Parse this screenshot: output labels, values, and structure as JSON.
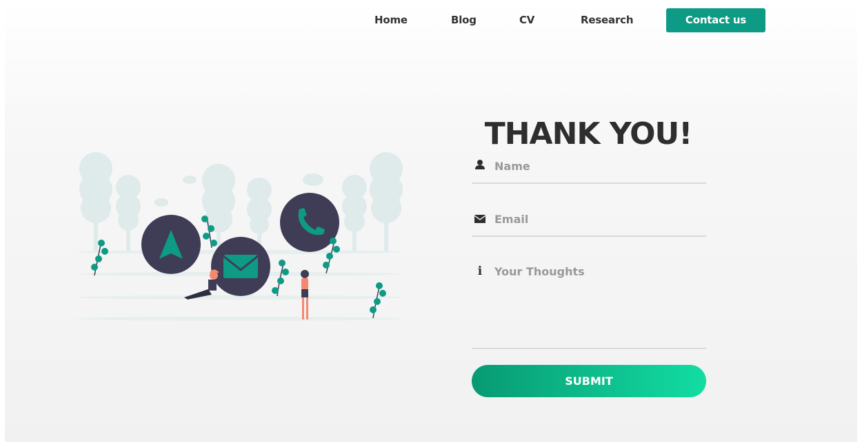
{
  "nav": {
    "items": [
      "Home",
      "Blog",
      "CV",
      "Research"
    ],
    "cta": "Contact us"
  },
  "form": {
    "title": "THANK YOU!",
    "name_placeholder": "Name",
    "email_placeholder": "Email",
    "thoughts_placeholder": "Your Thoughts",
    "submit_label": "SUBMIT"
  },
  "icons": {
    "name": "user-icon",
    "email": "envelope-icon",
    "thoughts": "info-icon",
    "illustration": [
      "navigation-arrow-icon",
      "mail-icon",
      "phone-icon"
    ]
  },
  "colors": {
    "accent": "#0e9b85",
    "submit_gradient_start": "#089a72",
    "submit_gradient_end": "#12dda2",
    "circle": "#3f3d56"
  }
}
